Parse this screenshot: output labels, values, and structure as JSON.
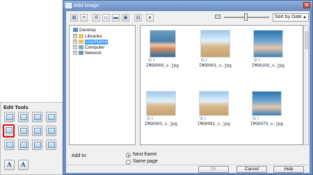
{
  "edit_tools": {
    "title": "Edit Tools",
    "text_buttons": [
      "A",
      "A"
    ]
  },
  "dialog": {
    "title": "Add Image",
    "close_glyph": "×",
    "sort": {
      "selected": "Sort by Date",
      "arrow": "▲"
    },
    "tree": {
      "root": "Desktop",
      "items": [
        "Libraries",
        "UserName",
        "Computer",
        "Network"
      ],
      "expand_glyph": "+"
    },
    "thumbnails": [
      {
        "name": "IMG0000_s.jpg",
        "meta": "🛈 1"
      },
      {
        "name": "IMG0001_s.jpg",
        "meta": "🛈 1"
      },
      {
        "name": "IMG0109_s.jpg",
        "meta": "🛈 1"
      },
      {
        "name": "IMG0003_s.jpg",
        "meta": "🛈 1"
      },
      {
        "name": "IMG0081_s.jpg",
        "meta": "🛈 1"
      },
      {
        "name": "IMG0079_s.jpg",
        "meta": "🛈 1"
      }
    ],
    "add_to": {
      "label": "Add to:",
      "options": [
        "Next frame",
        "Same page"
      ],
      "selected": "Next frame"
    },
    "buttons": {
      "ok": "OK",
      "cancel": "Cancel",
      "help": "Help"
    }
  }
}
